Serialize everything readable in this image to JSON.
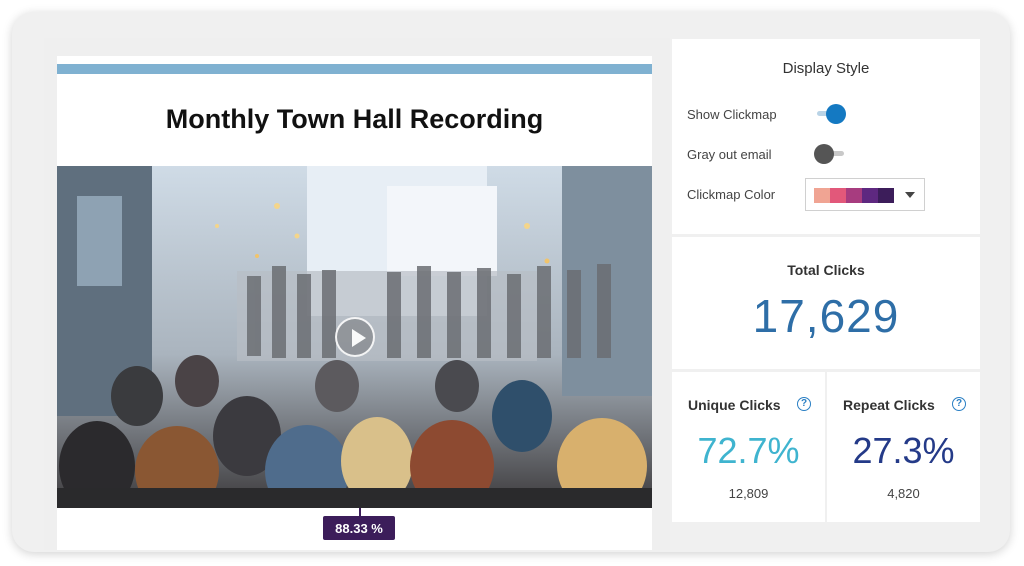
{
  "email": {
    "title": "Monthly Town Hall Recording",
    "click_badge": "88.33 %"
  },
  "display_style": {
    "heading": "Display Style",
    "show_clickmap": {
      "label": "Show Clickmap",
      "on": true
    },
    "gray_out_email": {
      "label": "Gray out email",
      "on": false
    },
    "clickmap_color": {
      "label": "Clickmap Color",
      "swatches": [
        "#f0a493",
        "#e2587a",
        "#a73c7f",
        "#5e2880",
        "#3c1d5a"
      ]
    }
  },
  "total_clicks": {
    "label": "Total Clicks",
    "value": "17,629"
  },
  "unique_clicks": {
    "label": "Unique Clicks",
    "pct": "72.7%",
    "count": "12,809",
    "color": "#3fb4cf"
  },
  "repeat_clicks": {
    "label": "Repeat Clicks",
    "pct": "27.3%",
    "count": "4,820",
    "color": "#243a88"
  },
  "icons": {
    "help": "?"
  },
  "colors": {
    "accent": "#1479c2",
    "total": "#2e6ea7",
    "badge": "#3c1d5a",
    "email_bar": "#7fb1d1"
  }
}
